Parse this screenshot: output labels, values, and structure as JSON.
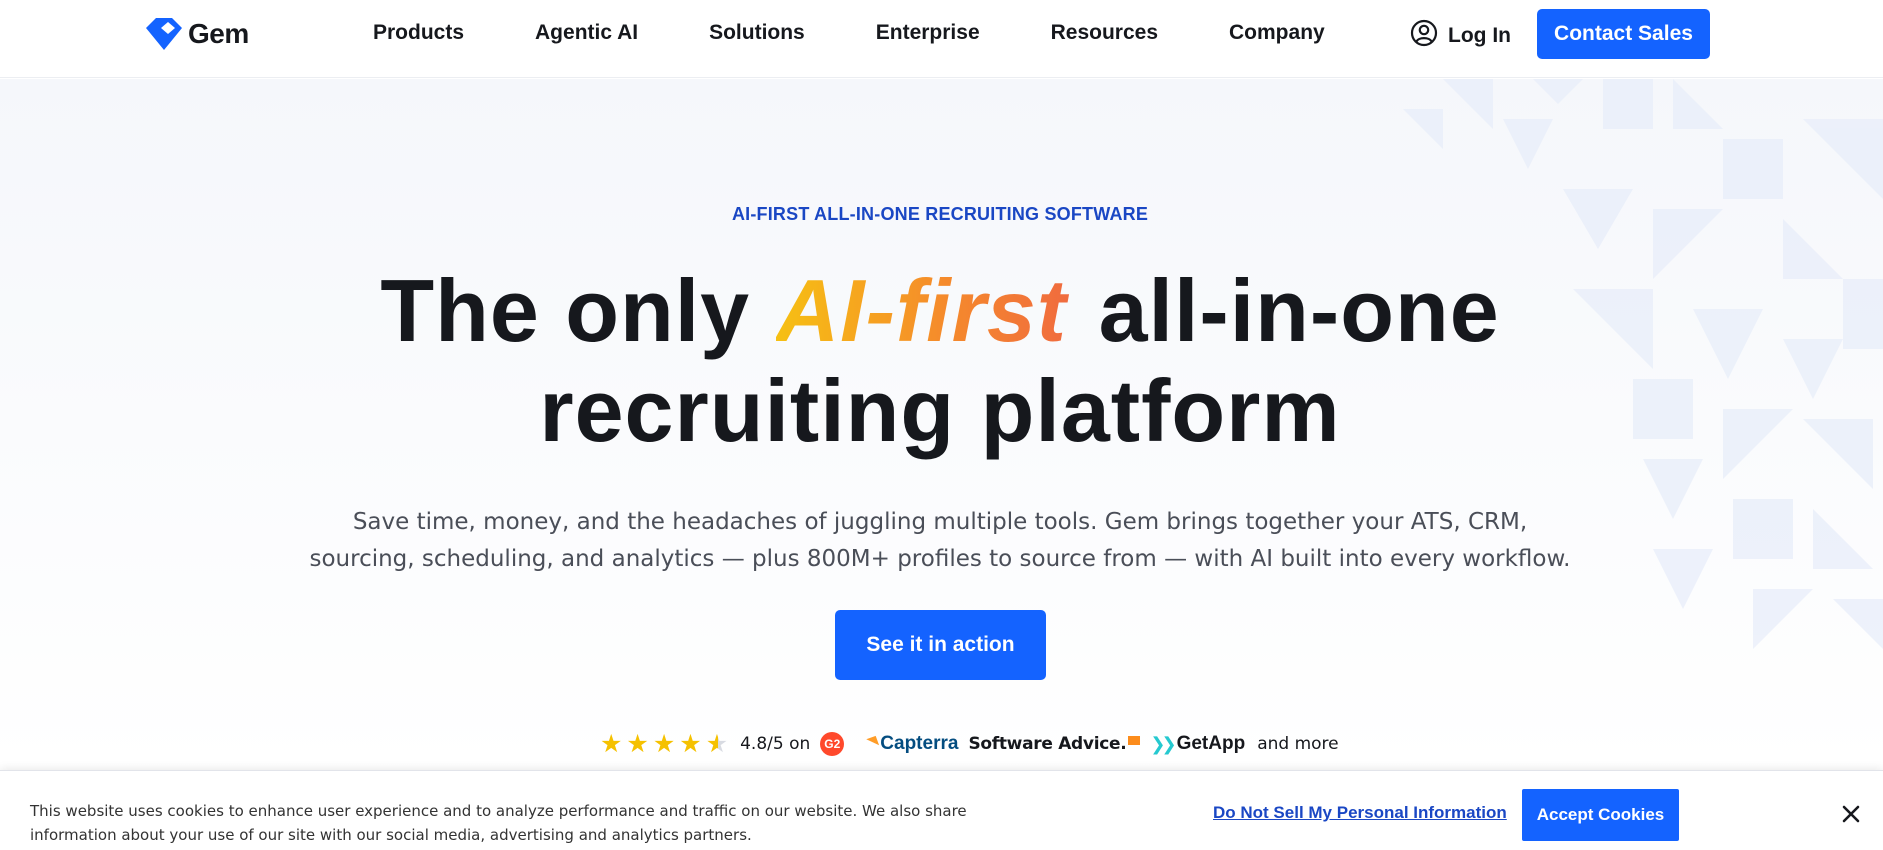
{
  "nav": {
    "brand": "Gem",
    "links": [
      "Products",
      "Agentic AI",
      "Solutions",
      "Enterprise",
      "Resources",
      "Company"
    ],
    "login_label": "Log In",
    "contact_label": "Contact Sales"
  },
  "hero": {
    "eyebrow": "AI-FIRST ALL-IN-ONE RECRUITING SOFTWARE",
    "headline_pre": "The only ",
    "headline_accent": "AI-first",
    "headline_post": " all-in-one",
    "headline_line2": "recruiting platform",
    "subtitle_line1": "Save time, money, and the headaches of juggling multiple tools. Gem brings together your ATS, CRM,",
    "subtitle_line2": "sourcing, scheduling, and analytics — plus 800M+ profiles to source from — with AI built into every workflow.",
    "cta_label": "See it in action"
  },
  "rating": {
    "stars": 4.5,
    "value_text": "4.8/5 on",
    "g2": "G2",
    "capterra": "Capterra",
    "software_advice": "Software Advice.",
    "getapp": "GetApp",
    "more": "and more"
  },
  "cookie": {
    "text": "This website uses cookies to enhance user experience and to analyze performance and traffic on our website. We also share information about your use of our site with our social media, advertising and analytics partners.",
    "dns_label": "Do Not Sell My Personal Information",
    "accept_label": "Accept Cookies"
  },
  "colors": {
    "brand_blue": "#1463ff",
    "eyebrow_blue": "#1a47c4",
    "accent_gradient_start": "#f6c013",
    "accent_gradient_end": "#f06a3f",
    "star": "#f5c100"
  },
  "icons": {
    "brand": "gem-diamond-icon",
    "login": "user-circle-icon",
    "close": "close-icon"
  }
}
